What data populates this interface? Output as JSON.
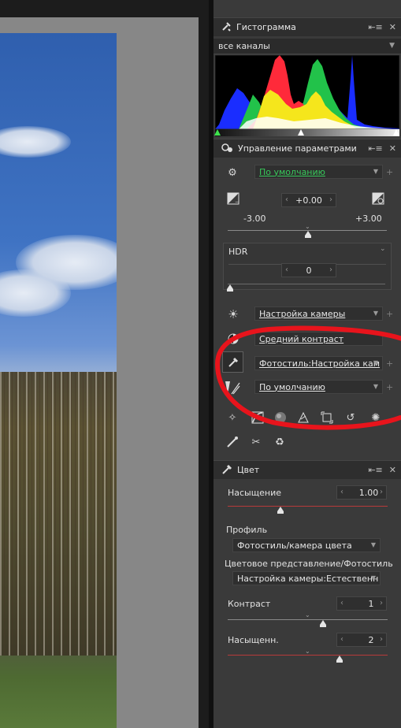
{
  "histogram": {
    "title": "Гистограмма",
    "channel": "все каналы"
  },
  "params": {
    "title": "Управление параметрами",
    "preset_value": "По умолчанию",
    "exposure": {
      "value": "+0.00",
      "min": "-3.00",
      "max": "+3.00"
    },
    "hdr": {
      "label": "HDR",
      "value": "0"
    },
    "wb_value": "Настройка камеры",
    "contrast_value": "Средний контраст",
    "picture_style_value": "Фотостиль:Настройка кам",
    "lens_value": "По умолчанию"
  },
  "color": {
    "title": "Цвет",
    "saturation": {
      "label": "Насыщение",
      "value": "1.00"
    },
    "profile_label": "Профиль",
    "profile_value": "Фотостиль/камера цвета",
    "space_label": "Цветовое представление/Фотостиль",
    "space_value": "Настройка камеры:Естественн",
    "contrast": {
      "label": "Контраст",
      "value": "1"
    },
    "saturation2": {
      "label": "Насыщенн.",
      "value": "2"
    }
  },
  "colors": {
    "annotation": "#e8141c",
    "accent_green": "#37c85a",
    "panel_bg": "#3a3a3a"
  },
  "icons": [
    "wrench-hammer-icon",
    "menu-icon",
    "close-icon",
    "gear-icon",
    "exposure-icon",
    "auto-exposure-icon",
    "sun-icon",
    "contrast-icon",
    "eyedropper-icon",
    "lens-icon",
    "crop-icon",
    "curves-icon",
    "sphere-icon",
    "perspective-icon",
    "resize-icon",
    "rotate-icon",
    "sparkle-icon",
    "brush-icon",
    "scissors-icon",
    "recycle-icon"
  ]
}
